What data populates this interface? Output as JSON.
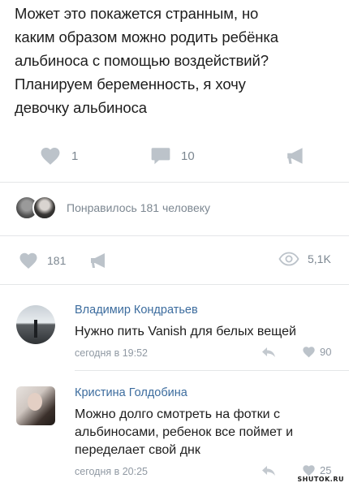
{
  "post": {
    "text": "Может это покажется странным, но\nкаким образом можно родить ребёнка\nальбиноса с помощью воздействий?\nПланируем беременность, я хочу\nдевочку альбиноса",
    "like_count": "1",
    "comment_count": "10"
  },
  "likes": {
    "text": "Понравилось 181 человеку"
  },
  "stats": {
    "like_count": "181",
    "views": "5,1K"
  },
  "comments": [
    {
      "author": "Владимир Кондратьев",
      "text": "Нужно пить Vanish для белых вещей",
      "time": "сегодня в 19:52",
      "likes": "90"
    },
    {
      "author": "Кристина Голдобина",
      "text": "Можно долго смотреть на фотки с\nальбиносами, ребенок все поймет и\nпеределает свой днк",
      "time": "сегодня в 20:25",
      "likes": "25"
    }
  ],
  "watermark": "SHUTOK.RU",
  "icons": {
    "heart": "heart-icon",
    "comment": "comment-icon",
    "share": "share-icon",
    "eye": "eye-icon",
    "reply": "reply-icon"
  },
  "colors": {
    "icon_gray": "#7c8791",
    "link_blue": "#3c6c9e"
  }
}
